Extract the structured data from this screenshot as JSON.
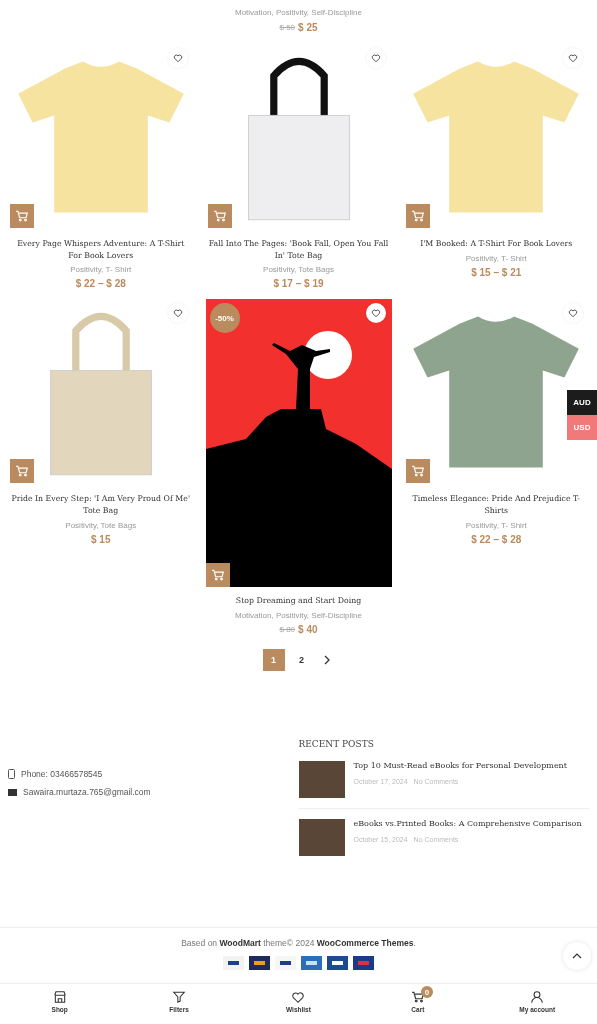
{
  "top_product": {
    "categories": "Motivation, Positivity, Self-Discipline",
    "old_price": "$ 50",
    "price": "$ 25"
  },
  "products": [
    {
      "kind": "tshirt",
      "color": "#f6e3a0",
      "title": "Every Page Whispers Adventure: A T-Shirt For Book Lovers",
      "categories": "Positivity, T- Shirt",
      "price": "$ 22 – $ 28"
    },
    {
      "kind": "tote",
      "color": "#eeeef0",
      "title": "Fall Into The Pages: 'Book Fall, Open You Fall In' Tote Bag",
      "categories": "Positivity, Tote Bags",
      "price": "$ 17 – $ 19"
    },
    {
      "kind": "tshirt",
      "color": "#f6e3a0",
      "title": "I'M Booked: A T-Shirt For Book Lovers",
      "categories": "Positivity, T- Shirt",
      "price": "$ 15 – $ 21"
    },
    {
      "kind": "tote",
      "color": "#e2d6bc",
      "title": "Pride In Every Step: 'I Am Very Proud Of Me' Tote Bag",
      "categories": "Positivity, Tote Bags",
      "price": "$ 15"
    },
    {
      "kind": "book",
      "color": "#f2312e",
      "badge": "-50%",
      "title": "Stop Dreaming and Start Doing",
      "categories": "Motivation, Positivity, Self-Discipline",
      "old_price": "$ 80",
      "price": "$ 40"
    },
    {
      "kind": "tshirt",
      "color": "#8fa48e",
      "title": "Timeless Elegance: Pride And Prejudice T-Shirts",
      "categories": "Positivity, T- Shirt",
      "price": "$ 22 – $ 28"
    }
  ],
  "currencies": [
    {
      "label": "AUD",
      "selected": true
    },
    {
      "label": "USD",
      "selected": false
    }
  ],
  "pagination": [
    {
      "label": "1",
      "selected": true
    },
    {
      "label": "2",
      "selected": false
    }
  ],
  "contact": {
    "phone": "Phone: 03466578545",
    "email": "Sawaira.murtaza.765@gmail.com"
  },
  "recent_posts": {
    "heading": "RECENT POSTS",
    "posts": [
      {
        "title": "Top 10 Must-Read eBooks for Personal Development",
        "date": "October 17, 2024",
        "comments": "No Comments"
      },
      {
        "title": "eBooks vs.Printed Books: A Comprehensive Comparison",
        "date": "October 15, 2024",
        "comments": "No Comments"
      }
    ]
  },
  "copyright": "Based on **WoodMart** theme© 2024 **WooCommerce Themes**.",
  "bottom_nav": [
    {
      "kind": "shop",
      "label": "Shop"
    },
    {
      "kind": "filters",
      "label": "Filters"
    },
    {
      "kind": "wishlist",
      "label": "Wishlist"
    },
    {
      "kind": "cart",
      "label": "Cart",
      "badge": "0"
    },
    {
      "kind": "account",
      "label": "My account"
    }
  ]
}
